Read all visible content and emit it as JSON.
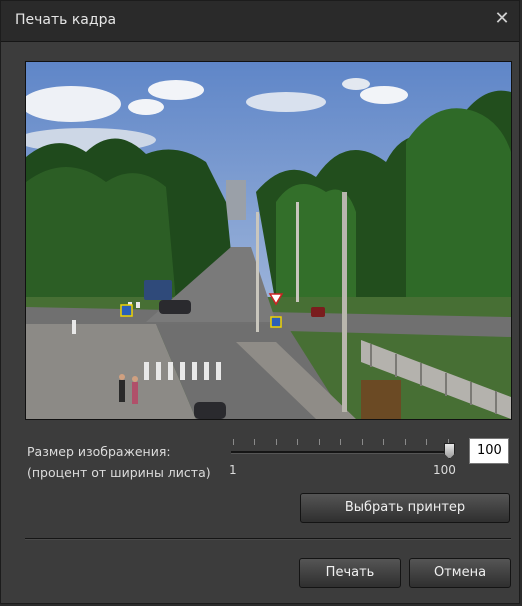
{
  "window": {
    "title": "Печать кадра",
    "close_icon": "close-icon"
  },
  "preview": {
    "description_icon": "camera-frame-image"
  },
  "size": {
    "label_line1": "Размер изображения:",
    "label_line2": "(процент от ширины листа)",
    "min": "1",
    "max": "100",
    "value": "100"
  },
  "buttons": {
    "select_printer": "Выбрать принтер",
    "print": "Печать",
    "cancel": "Отмена"
  }
}
